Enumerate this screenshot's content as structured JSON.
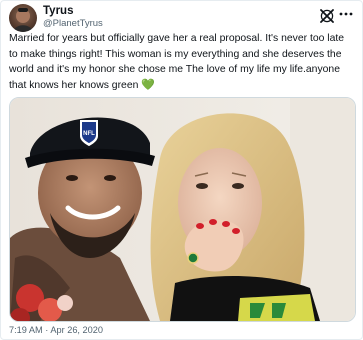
{
  "tweet": {
    "display_name": "Tyrus",
    "handle": "@PlanetTyrus",
    "text": "Married for years but officially gave her a real proposal. It's never too late to make things right! This woman is my everything and she deserves the world and it's my honor she chose me The love of my life my life.anyone that knows her knows green",
    "emoji": "💚",
    "timestamp": "7:19 AM · Apr 26, 2020",
    "cap_logo_text": "NFL"
  },
  "icons": {
    "brand": "x-logo-icon",
    "menu": "more-options-icon"
  },
  "colors": {
    "text": "#0f1419",
    "secondary": "#536471",
    "green_heart": "#2bb24c"
  }
}
